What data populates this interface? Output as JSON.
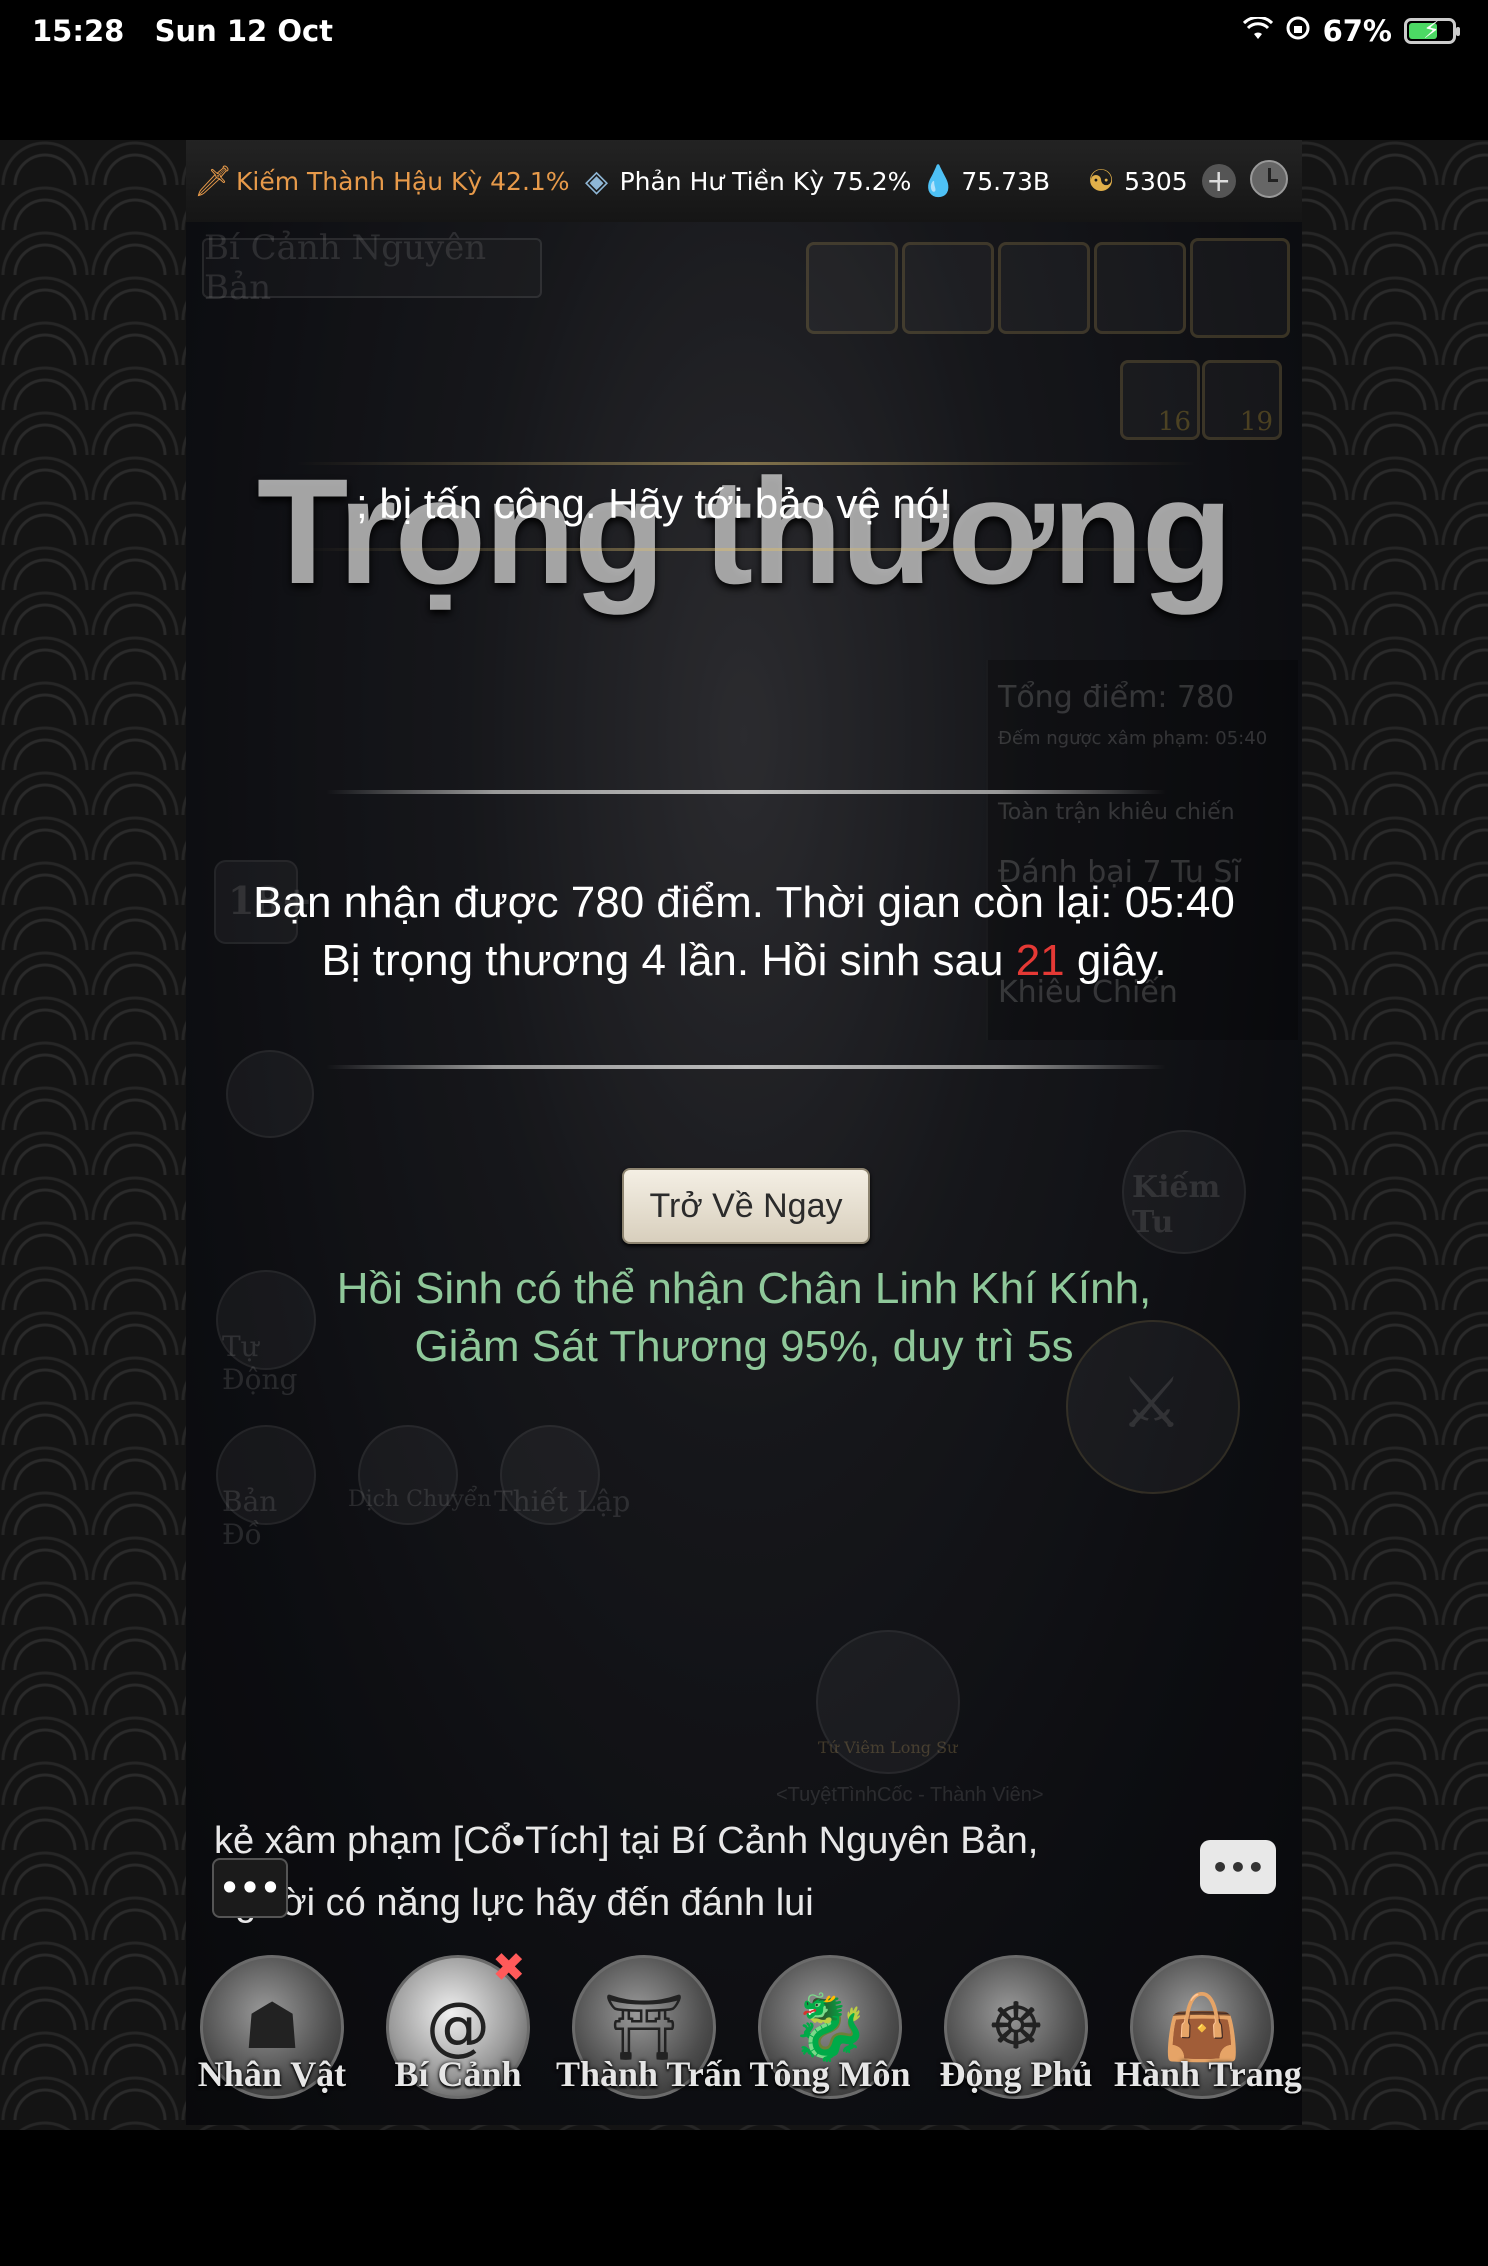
{
  "status_bar": {
    "time": "15:28",
    "date": "Sun 12 Oct",
    "battery": "67%"
  },
  "resources": {
    "realm1": "Kiếm Thành Hậu Kỳ 42.1%",
    "realm1_color": "#e79a4a",
    "realm2": "Phản Hư Tiền Kỳ 75.2%",
    "crystal": "75.73B",
    "coins": "5305"
  },
  "background": {
    "map_title": "Bí Cảnh Nguyên Bản",
    "slot_count_1": "16",
    "slot_count_2": "19",
    "total_score": "Tổng điểm: 780",
    "countdown_label": "Đếm ngược xâm phạm: 05:40",
    "server_challenge": "Toàn trận khiêu chiến",
    "defeat_text": "Đánh bại 7 Tu Sĩ",
    "challenge": "Khiêu Chiến",
    "cultivate": "Kiếm Tu",
    "auto_battle": "Tự Động",
    "map": "Bản Đồ",
    "teleport": "Dịch Chuyển",
    "settings": "Thiết Lập",
    "level_badge": "18+",
    "boss_name": "Tứ Viêm Long Sư",
    "guild_member": "<TuyệtTìnhCốc - Thành Viên>"
  },
  "overlay": {
    "headline": "Trọng thương",
    "alert": "; bị tấn công. Hãy tới bảo vệ nó!",
    "info_line1": "Bạn nhận được 780 điểm. Thời gian còn lại: 05:40",
    "info_line2_prefix": "Bị trọng thương 4 lần. Hồi sinh sau ",
    "info_line2_seconds": "21",
    "info_line2_suffix": " giây.",
    "return_button": "Trở Về Ngay",
    "buff_line1": "Hồi Sinh có thể nhận Chân Linh Khí Kính,",
    "buff_line2": "Giảm Sát Thương 95%, duy trì 5s"
  },
  "chat": {
    "line1": "kẻ xâm phạm [Cổ•Tích] tại Bí Cảnh Nguyên Bản,",
    "line2": "người có năng lực hãy đến đánh lui",
    "more_label": "•••",
    "bubble_label": "•••"
  },
  "nav": [
    {
      "label": "Nhân Vật",
      "icon": "character-icon"
    },
    {
      "label": "Bí Cảnh",
      "icon": "secret-realm-icon"
    },
    {
      "label": "Thành Trấn",
      "icon": "town-icon"
    },
    {
      "label": "Tông Môn",
      "icon": "sect-icon"
    },
    {
      "label": "Động Phủ",
      "icon": "cave-icon"
    },
    {
      "label": "Hành Trang",
      "icon": "bag-icon"
    }
  ]
}
